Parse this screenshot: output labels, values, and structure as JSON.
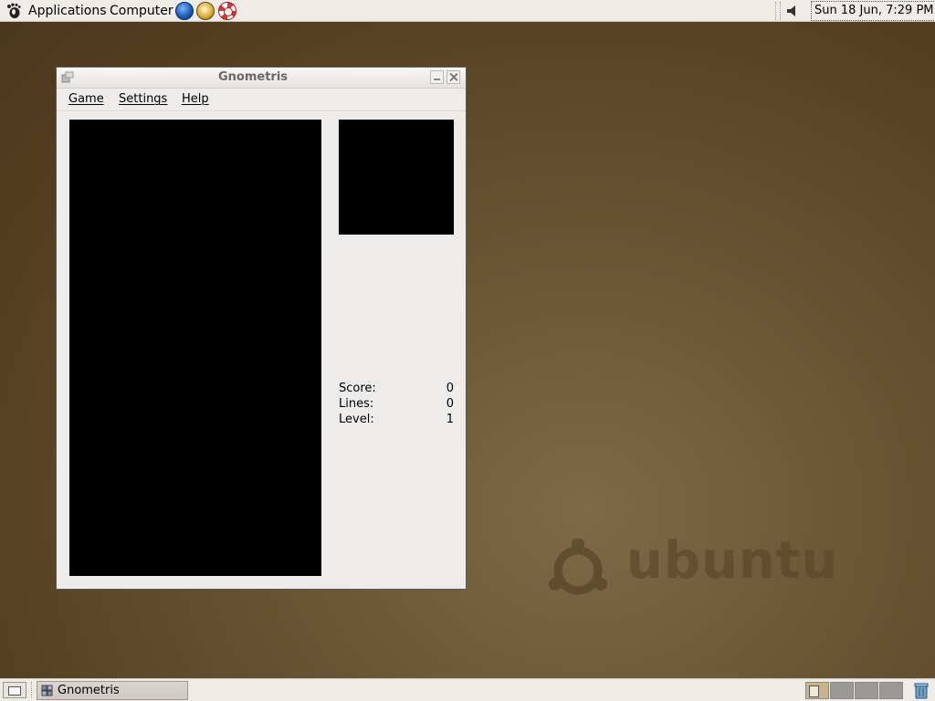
{
  "top_panel": {
    "menus": [
      "Applications",
      "Computer"
    ],
    "launchers": [
      "web-browser",
      "evolution-mail",
      "help"
    ],
    "clock": "Sun 18 Jun,  7:29 PM"
  },
  "window": {
    "title": "Gnometris",
    "menu": [
      {
        "accel": "G",
        "rest": "ame"
      },
      {
        "accel": "S",
        "rest": "ettings"
      },
      {
        "accel": "H",
        "rest": "elp"
      }
    ],
    "stats": [
      {
        "label": "Score:",
        "value": "0"
      },
      {
        "label": "Lines:",
        "value": "0"
      },
      {
        "label": "Level:",
        "value": "1"
      }
    ]
  },
  "desktop": {
    "wallpaper_text": "ubuntu"
  },
  "bottom_panel": {
    "task_label": "Gnometris",
    "workspaces": 4,
    "active_workspace": 1
  },
  "colors": {
    "panel": "#efebe7",
    "desktop": "#6a5535",
    "board": "#000000"
  }
}
